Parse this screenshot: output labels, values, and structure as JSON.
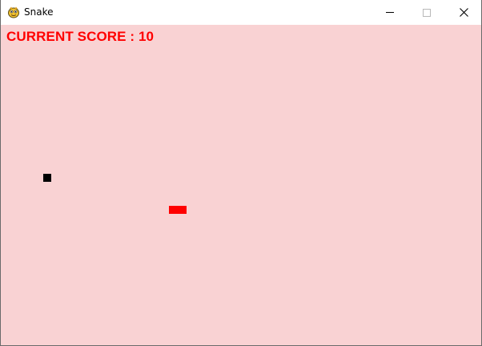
{
  "window": {
    "title": "Snake",
    "icon": "pygame-snake-icon",
    "controls": {
      "minimize_icon": "minimize-icon",
      "maximize_icon": "maximize-icon",
      "close_icon": "close-icon"
    }
  },
  "game": {
    "score_text": "CURRENT SCORE : 10",
    "background_color": "#f9d2d3",
    "score_color": "#ff0000",
    "snake_color": "#ff0000",
    "food_color": "#000000"
  }
}
